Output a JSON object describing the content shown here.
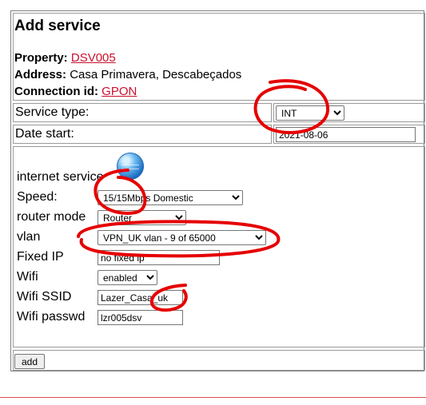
{
  "header": {
    "title": "Add service",
    "property_label": "Property:",
    "property_value": "DSV005",
    "address_label": "Address:",
    "address_value": "Casa Primavera, Descabeçados",
    "connection_label": "Connection id:",
    "connection_value": "GPON"
  },
  "service_type": {
    "label": "Service type:",
    "value": "INT"
  },
  "date_start": {
    "label": "Date start:",
    "value": "2021-08-06"
  },
  "form": {
    "section_title": "internet service",
    "speed": {
      "label": "Speed:",
      "value": "15/15Mbps Domestic"
    },
    "router_mode": {
      "label": "router mode",
      "value": "Router"
    },
    "vlan": {
      "label": "vlan",
      "value": "VPN_UK vlan - 9 of 65000"
    },
    "fixed_ip": {
      "label": "Fixed IP",
      "value": "no fixed ip"
    },
    "wifi": {
      "label": "Wifi",
      "value": "enabled"
    },
    "wifi_ssid": {
      "label": "Wifi SSID",
      "value": "Lazer_Casa_uk"
    },
    "wifi_passwd": {
      "label": "Wifi passwd",
      "value": "lzr005dsv"
    }
  },
  "footer": {
    "add_label": "add"
  },
  "colors": {
    "link": "#c8102e",
    "annotation": "#e60000"
  },
  "icons": {
    "globe": "globe-icon"
  }
}
